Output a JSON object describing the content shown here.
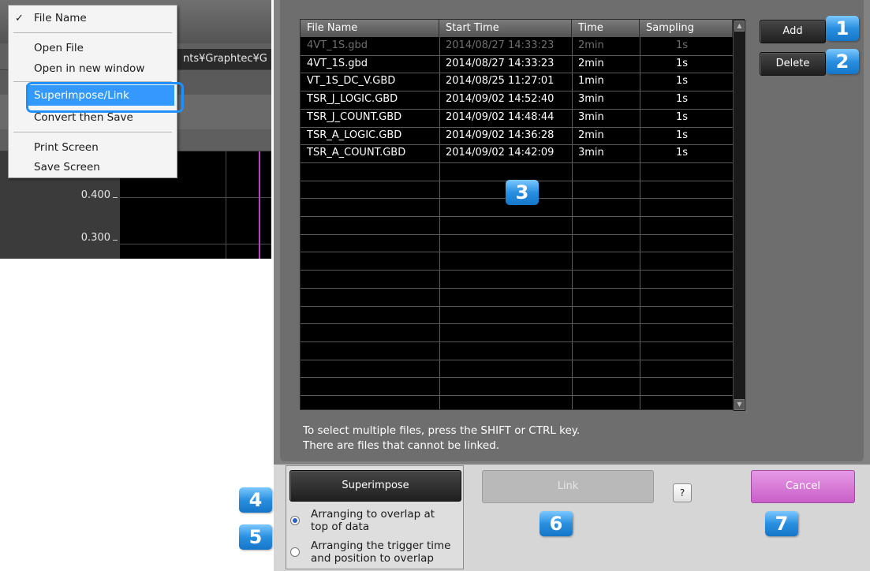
{
  "context_menu": {
    "items": [
      {
        "label": "File Name",
        "checked": true
      },
      {
        "label": "Open File"
      },
      {
        "label": "Open in new window"
      },
      {
        "label": "Superimpose/Link",
        "selected": true
      },
      {
        "label": "Convert then Save"
      },
      {
        "label": "Print Screen"
      },
      {
        "label": "Save Screen"
      }
    ],
    "check_glyph": "✓"
  },
  "background_app": {
    "path_text": "nts¥Graphtec¥G",
    "y_axis_labels": [
      "0.400",
      "0.300"
    ]
  },
  "dialog": {
    "buttons": {
      "add": "Add",
      "delete": "Delete",
      "help": "?"
    },
    "file_list": {
      "columns": [
        "File Name",
        "Start Time",
        "Time",
        "Sampling"
      ],
      "rows": [
        {
          "name": "4VT_1S.gbd",
          "start": "2014/08/27 14:33:23",
          "time": "2min",
          "sampling": "1s",
          "disabled": true
        },
        {
          "name": "4VT_1S.gbd",
          "start": "2014/08/27 14:33:23",
          "time": "2min",
          "sampling": "1s"
        },
        {
          "name": "VT_1S_DC_V.GBD",
          "start": "2014/08/25 11:27:01",
          "time": "1min",
          "sampling": "1s"
        },
        {
          "name": "TSR_J_LOGIC.GBD",
          "start": "2014/09/02 14:52:40",
          "time": "3min",
          "sampling": "1s"
        },
        {
          "name": "TSR_J_COUNT.GBD",
          "start": "2014/09/02 14:48:44",
          "time": "3min",
          "sampling": "1s"
        },
        {
          "name": "TSR_A_LOGIC.GBD",
          "start": "2014/09/02 14:36:28",
          "time": "2min",
          "sampling": "1s"
        },
        {
          "name": "TSR_A_COUNT.GBD",
          "start": "2014/09/02 14:42:09",
          "time": "3min",
          "sampling": "1s"
        }
      ],
      "scroll_up_glyph": "▲",
      "scroll_down_glyph": "▼"
    },
    "hint_line1": "To select multiple files, press the SHIFT or CTRL key.",
    "hint_line2": "There are files that cannot be linked.",
    "superimpose_label": "Superimpose",
    "link_label": "Link",
    "cancel_label": "Cancel",
    "options": [
      {
        "label_line1": "Arranging to overlap at",
        "label_line2": "top of data",
        "checked": true
      },
      {
        "label_line1": "Arranging the trigger time",
        "label_line2": "and position to overlap",
        "checked": false
      }
    ]
  },
  "callouts": [
    "1",
    "2",
    "3",
    "4",
    "5",
    "6",
    "7"
  ],
  "colors": {
    "callout_blue": "#2a8fe0",
    "menu_highlight": "#3399ff",
    "cancel_pink": "#d67ad6",
    "trace_magenta": "#c23cc2"
  }
}
